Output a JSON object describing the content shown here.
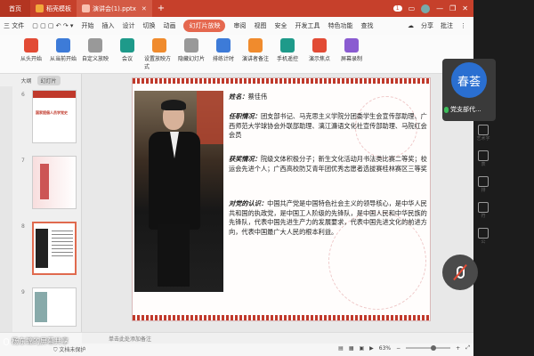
{
  "titlebar": {
    "home_label": "首页",
    "tabs": [
      {
        "label": "稻壳模板",
        "badge_color": "#f2a83b"
      },
      {
        "label": "演讲会(1).pptx",
        "badge_color": "#e86548"
      }
    ],
    "add_tab": "+",
    "window_count": "1",
    "right_icons": [
      "monitor-icon",
      "avatar",
      "minimize-icon",
      "maximize-icon",
      "close-icon"
    ]
  },
  "menu": {
    "file_label": "三 文件",
    "items": [
      "开始",
      "插入",
      "设计",
      "切换",
      "动画",
      "幻灯片放映",
      "审阅",
      "视图",
      "安全",
      "开发工具",
      "特色功能",
      "查找"
    ],
    "active_item": "幻灯片放映",
    "right": [
      "分享",
      "批注"
    ]
  },
  "ribbon": {
    "buttons": [
      {
        "label": "从头开始",
        "color": "red"
      },
      {
        "label": "从当前开始",
        "color": "blue"
      },
      {
        "label": "自定义放映",
        "color": "gray"
      },
      {
        "label": "会议",
        "color": "teal"
      },
      {
        "label": "设置放映方式",
        "color": "orange"
      },
      {
        "label": "隐藏幻灯片",
        "color": "gray"
      },
      {
        "label": "排练计时",
        "color": "blue"
      },
      {
        "label": "演讲者备注",
        "color": "orange"
      },
      {
        "label": "手机遥控",
        "color": "teal"
      },
      {
        "label": "演示焦点",
        "color": "red"
      },
      {
        "label": "屏幕录制",
        "color": "purple"
      }
    ]
  },
  "leftpane": {
    "tabs": [
      "大纲",
      "幻灯片"
    ],
    "active_tab": "幻灯片",
    "thumbs": [
      {
        "num": "6",
        "text": "国家提倡人员学党史"
      },
      {
        "num": "7",
        "text": ""
      },
      {
        "num": "8",
        "text": ""
      },
      {
        "num": "9",
        "text": ""
      }
    ],
    "selected_num": "8"
  },
  "slide": {
    "name_label": "姓名：",
    "name_value": "蔡佳伟",
    "role_label": "任职情况：",
    "role_value": "团支部书记、马克思主义学院分团委学生会宣传部助理、广西师范大学球协会外联部助理、漓江濂语文化社宣传部助理、马院红会会员",
    "award_label": "获奖情况：",
    "award_value": "院级文体积极分子；新生文化活动月书法类比赛二等奖；校运会先进个人；广西高校防艾青年团优秀志愿者选拔赛桂林赛区三等奖",
    "party_label": "对党的认识：",
    "party_value": "中国共产党是中国特色社会主义的领导核心，是中华人民共和国的执政党，是中国工人阶级的先锋队，是中国人民和中华民族的先锋队，代表中国先进生产力的发展要求，代表中国先进文化的前进方向，代表中国最广大人民的根本利益。"
  },
  "statusbar": {
    "notes_placeholder": "单击此处添加备注",
    "left_text": "文档未保护",
    "zoom": "63%",
    "zoom_fraction": 0.63
  },
  "call": {
    "participant_initials": "春荟",
    "participant_name": "党支部代...",
    "share_label": "杨东锦的屏幕共享",
    "side_tools": [
      "艺术字",
      "表",
      "排",
      "符",
      "公"
    ]
  },
  "colors": {
    "titlebar": "#c6402b",
    "accent": "#e5684f",
    "avatar": "#2a6fd1"
  }
}
